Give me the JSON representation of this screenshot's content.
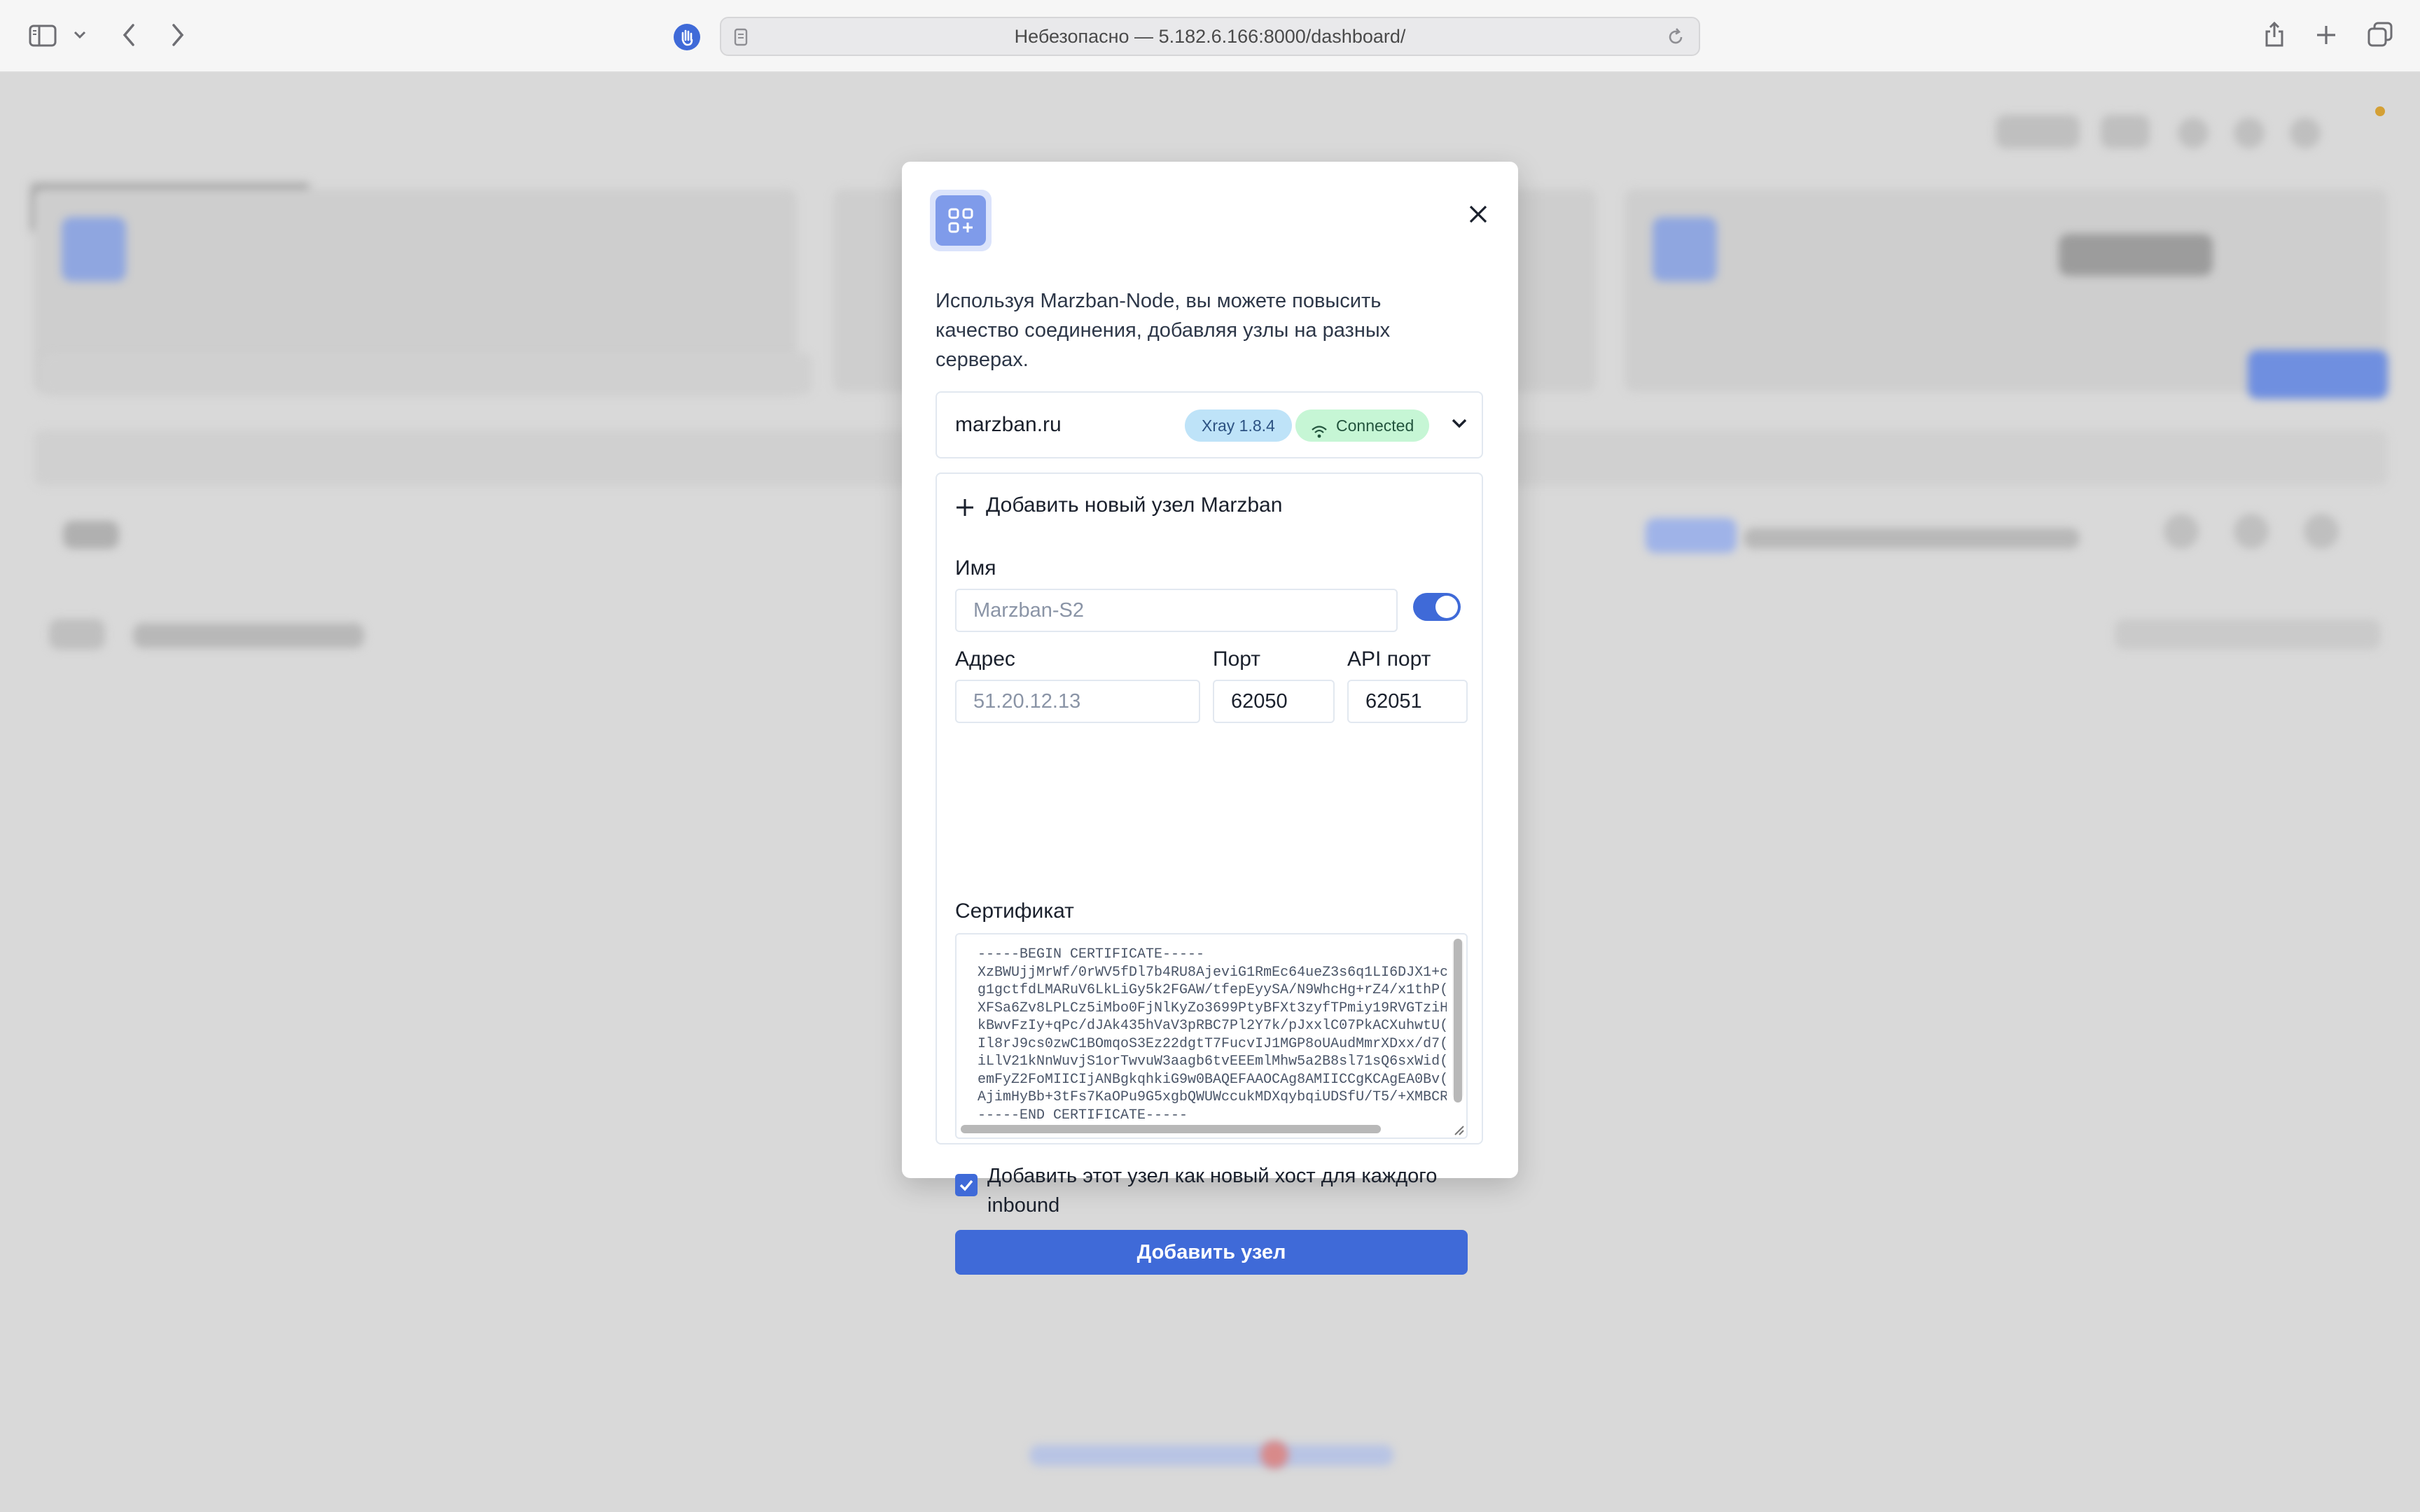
{
  "browser": {
    "address": "Небезопасно — 5.182.6.166:8000/dashboard/"
  },
  "modal": {
    "description": "Используя Marzban-Node, вы можете повысить качество соединения, добавляя узлы на разных серверах.",
    "node": {
      "name": "marzban.ru",
      "xray_badge": "Xray 1.8.4",
      "status_badge": "Connected"
    },
    "add_form": {
      "title": "Добавить новый узел Marzban",
      "name_label": "Имя",
      "name_placeholder": "Marzban-S2",
      "enabled": true,
      "address_label": "Адрес",
      "address_placeholder": "51.20.12.13",
      "port_label": "Порт",
      "port_value": "62050",
      "api_port_label": "API порт",
      "api_port_value": "62051",
      "certificate_label": "Сертификат",
      "certificate_text": "-----BEGIN CERTIFICATE-----\nXzBWUjjMrWf/0rWV5fDl7b4RU8AjeviG1RmEc64ueZ3s6q1LI6DJX1+c\ng1gctfdLMARuV6LkLiGy5k2FGAW/tfepEyySA/N9WhcHg+rZ4/x1thP(\nXFSa6Zv8LPLCz5iMbo0FjNlKyZo3699PtyBFXt3zyfTPmiy19RVGTziH\nkBwvFzIy+qPc/dJAk435hVaV3pRBC7Pl2Y7k/pJxxlC07PkACXuhwtU(\nIl8rJ9cs0zwC1BOmqoS3Ez22dgtT7FucvIJ1MGP8oUAudMmrXDxx/d7(\niLlV21kNnWuvjS1orTwvuW3aagb6tvEEEmlMhw5a2B8sl71sQ6sxWid(\nemFyZ2FoMIICIjANBgkqhkiG9w0BAQEFAAOCAg8AMIICCgKCAgEA0Bv(\nAjimHyBb+3tFs7KaOPu9G5xgbQWUWccukMDXqybqiUDSfU/T5/+XMBCR\n-----END CERTIFICATE-----",
      "checkbox_checked": true,
      "checkbox_label": "Добавить этот узел как новый хост для каждого inbound",
      "submit_label": "Добавить узел"
    }
  },
  "colors": {
    "accent": "#3f6ad8",
    "connected_badge_bg": "#c6f6d5",
    "xray_badge_bg": "#bee3f8"
  }
}
